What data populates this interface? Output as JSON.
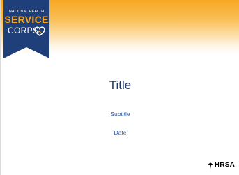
{
  "logo": {
    "line1": "NATIONAL HEALTH",
    "line2": "SERVICE",
    "line3": "CORPS"
  },
  "slide": {
    "title": "Title",
    "subtitle": "Subtitle",
    "date": "Date"
  },
  "footer": {
    "agency": "HRSA"
  },
  "colors": {
    "banner_navy": "#1f3f7a",
    "accent_orange": "#f7a823",
    "title_navy": "#1f3864",
    "subtitle_blue": "#2e5aa8"
  },
  "icons": [
    "heart-icon",
    "hrsa-eagle-icon"
  ]
}
